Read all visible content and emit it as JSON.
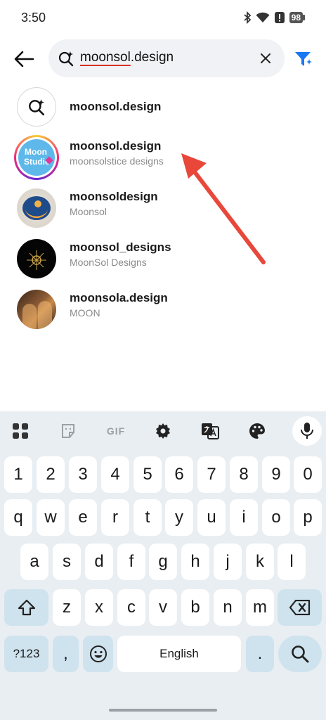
{
  "status_bar": {
    "time": "3:50",
    "battery": "98"
  },
  "search": {
    "query_misspelled_part": "moonsol",
    "query_rest": ".design"
  },
  "results": [
    {
      "title": "moonsol.design",
      "subtitle": ""
    },
    {
      "title": "moonsol.design",
      "subtitle": "moonsolstice designs",
      "avatar_text_1": "Moon",
      "avatar_text_2": "Studio"
    },
    {
      "title": "moonsoldesign",
      "subtitle": "Moonsol"
    },
    {
      "title": "moonsol_designs",
      "subtitle": "MoonSol Designs"
    },
    {
      "title": "moonsola.design",
      "subtitle": "MOON"
    }
  ],
  "keyboard": {
    "toolbar": {
      "gif": "GIF"
    },
    "row_numbers": [
      "1",
      "2",
      "3",
      "4",
      "5",
      "6",
      "7",
      "8",
      "9",
      "0"
    ],
    "row_1": [
      "q",
      "w",
      "e",
      "r",
      "t",
      "y",
      "u",
      "i",
      "o",
      "p"
    ],
    "row_2": [
      "a",
      "s",
      "d",
      "f",
      "g",
      "h",
      "j",
      "k",
      "l"
    ],
    "row_3": [
      "z",
      "x",
      "c",
      "v",
      "b",
      "n",
      "m"
    ],
    "symbols_key": "?123",
    "comma_key": ",",
    "space_key": "English",
    "period_key": "."
  },
  "colors": {
    "annotation_arrow": "#e8473a",
    "instagram_gradient": [
      "#f9ce34",
      "#ee2a7b",
      "#6228d7"
    ],
    "accent_blue": "#1877f2",
    "keyboard_bg": "#e8eef2"
  },
  "icons": [
    "back-arrow-icon",
    "search-sparkle-icon",
    "close-icon",
    "filter-icon",
    "apps-grid-icon",
    "sticker-icon",
    "gear-icon",
    "translate-icon",
    "palette-icon",
    "mic-icon",
    "shift-icon",
    "backspace-icon",
    "emoji-icon",
    "search-icon"
  ]
}
